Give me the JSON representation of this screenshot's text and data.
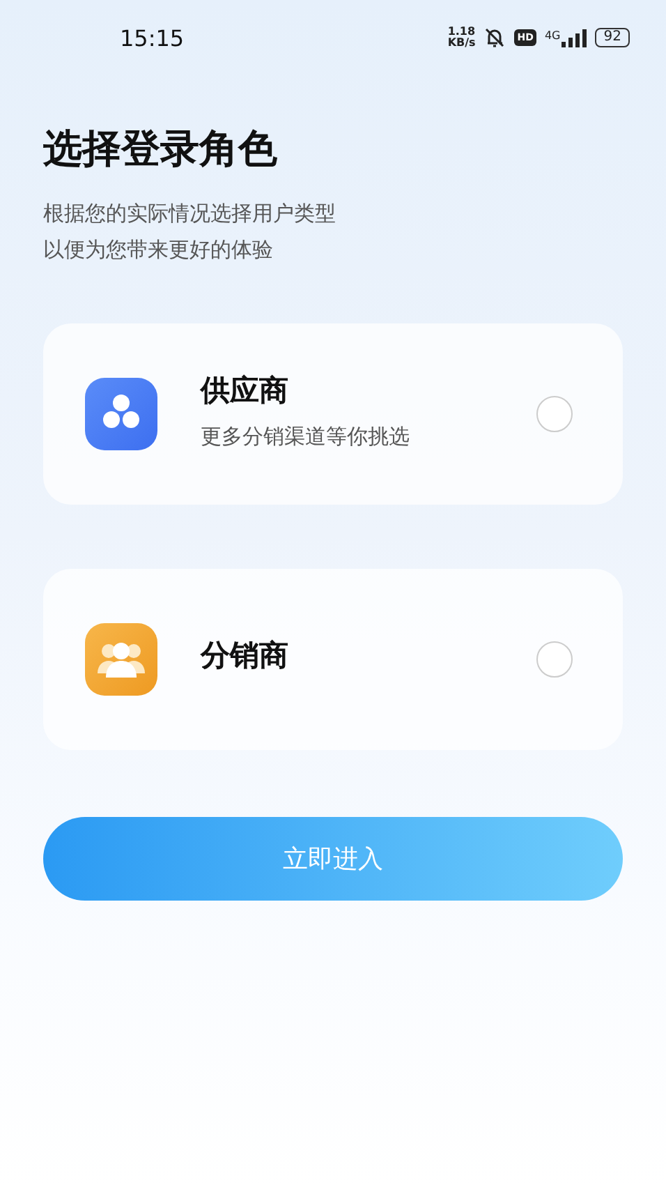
{
  "status_bar": {
    "time": "15:15",
    "speed_value": "1.18",
    "speed_unit": "KB/s",
    "hd_badge": "HD",
    "network": "4G",
    "battery": "92"
  },
  "title": "选择登录角色",
  "subtitle_lines": [
    "根据您的实际情况选择用户类型",
    "以便为您带来更好的体验"
  ],
  "roles": [
    {
      "kind": "supplier",
      "name": "供应商",
      "description": "更多分销渠道等你挑选",
      "selected": false
    },
    {
      "kind": "distributor",
      "name": "分销商",
      "selected": false
    }
  ],
  "enter_button": "立即进入"
}
